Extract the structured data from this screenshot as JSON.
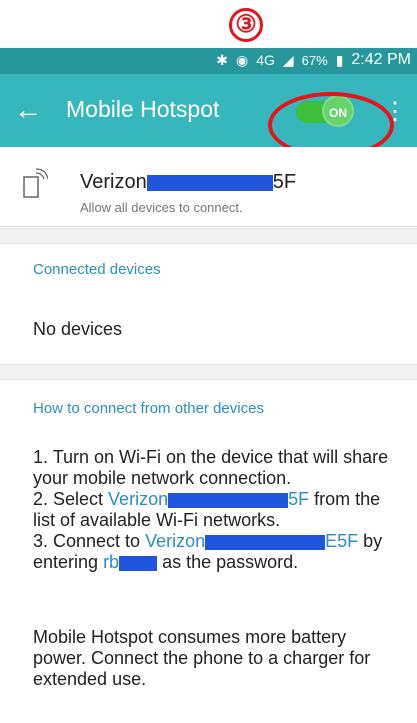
{
  "step": {
    "number": "③"
  },
  "status": {
    "battery": "67%",
    "time": "2:42 PM",
    "network": "4G"
  },
  "appbar": {
    "back_icon": "arrow-left-icon",
    "title": "Mobile Hotspot",
    "toggle_label": "ON",
    "toggle_on": true,
    "overflow_icon": "more-vert-icon"
  },
  "hotspot": {
    "ssid_prefix": "Verizon",
    "ssid_suffix": "5F",
    "subtitle": "Allow all devices to connect."
  },
  "connected": {
    "header": "Connected devices",
    "empty": "No devices"
  },
  "howto": {
    "header": "How to connect from other devices",
    "step1": "1. Turn on Wi-Fi on the device that will share your mobile network connection.",
    "step2_a": "2. Select ",
    "step2_link_prefix": "Verizon",
    "step2_link_suffix": "5F",
    "step2_b": " from the list of available Wi-Fi networks.",
    "step3_a": "3. Connect to ",
    "step3_link_prefix": "Verizon",
    "step3_link_suffix": "E5F",
    "step3_b": " by entering ",
    "step3_pw_prefix": "rb",
    "step3_c": " as the password."
  },
  "note": "Mobile Hotspot consumes more battery power. Connect the phone to a charger for extended use.",
  "colors": {
    "statusbar": "#25979d",
    "appbar": "#35b7bd",
    "toggle": "#3cbf3c",
    "highlight": "#e8141b",
    "link": "#2a8fbd"
  }
}
